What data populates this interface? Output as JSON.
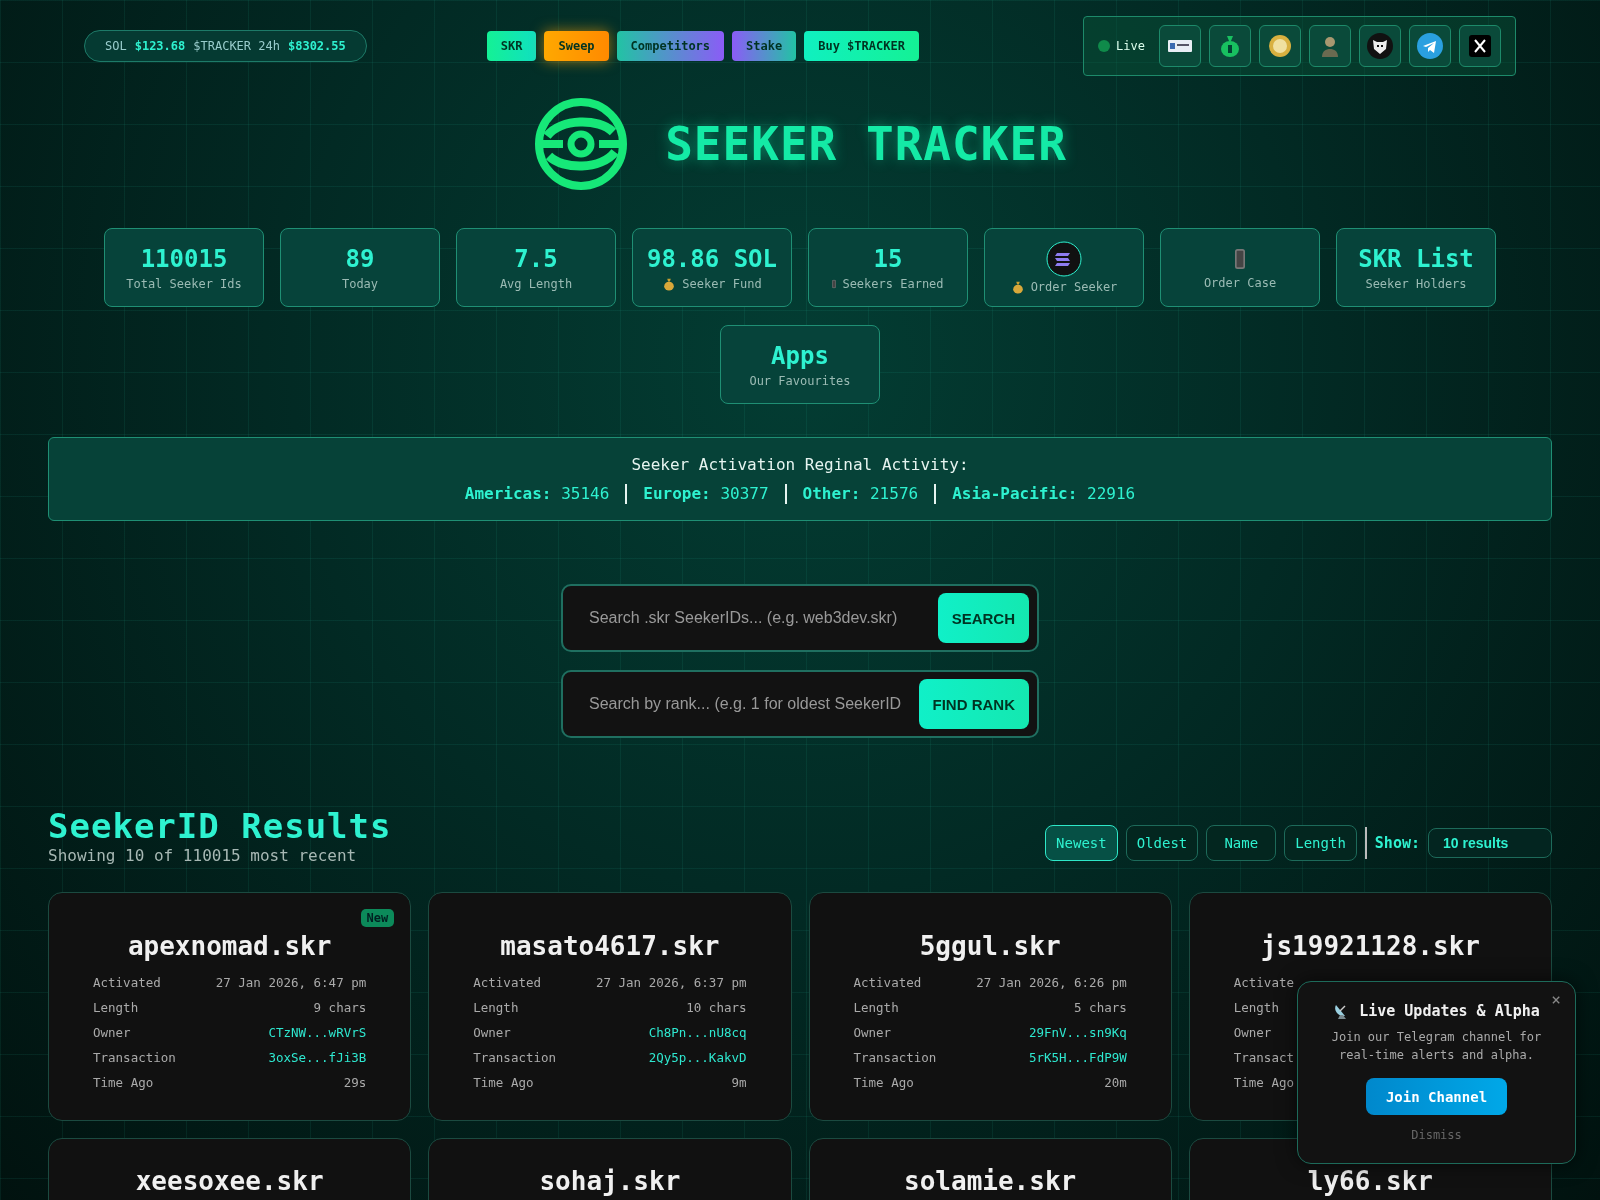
{
  "ticker": [
    {
      "label": "SOL",
      "value": "$123.68"
    },
    {
      "label": "$TRACKER 24h",
      "value": "$8302.55"
    }
  ],
  "nav": [
    {
      "label": "SKR",
      "kind": "skr"
    },
    {
      "label": "Sweep",
      "kind": "sweep"
    },
    {
      "label": "Competitors",
      "kind": "competitors"
    },
    {
      "label": "Stake",
      "kind": "stake"
    },
    {
      "label": "Buy $TRACKER",
      "kind": "buy"
    }
  ],
  "status": {
    "label": "Live",
    "on": true
  },
  "social": [
    {
      "kind": "badge"
    },
    {
      "kind": "money-bag"
    },
    {
      "kind": "coin"
    },
    {
      "kind": "figure"
    },
    {
      "kind": "mask"
    },
    {
      "kind": "telegram"
    },
    {
      "kind": "x"
    }
  ],
  "title": "SEEKER TRACKER",
  "stats": [
    {
      "kind": "text",
      "value": "110015",
      "label": "Total Seeker Ids"
    },
    {
      "kind": "text",
      "value": "89",
      "label": "Today"
    },
    {
      "kind": "text",
      "value": "7.5",
      "label": "Avg Length"
    },
    {
      "kind": "fund",
      "value": "98.86 SOL",
      "label": "Seeker Fund"
    },
    {
      "kind": "earned",
      "value": "15",
      "label": "Seekers Earned"
    },
    {
      "kind": "logo",
      "label": "Order Seeker"
    },
    {
      "kind": "phone",
      "label": "Order Case"
    },
    {
      "kind": "text",
      "value": "SKR List",
      "label": "Seeker Holders"
    },
    {
      "kind": "text",
      "value": "Apps",
      "label": "Our Favourites"
    }
  ],
  "region": {
    "title": "Seeker Activation Reginal Activity:",
    "items": [
      {
        "label": "Americas:",
        "value": "35146"
      },
      {
        "label": "Europe:",
        "value": "30377"
      },
      {
        "label": "Other:",
        "value": "21576"
      },
      {
        "label": "Asia-Pacific:",
        "value": "22916"
      }
    ]
  },
  "searches": [
    {
      "placeholder": "Search .skr SeekerIDs... (e.g. web3dev.skr)",
      "button": "SEARCH"
    },
    {
      "placeholder": "Search by rank... (e.g. 1 for oldest SeekerID",
      "button": "FIND RANK"
    }
  ],
  "results": {
    "title": "SeekerID Results",
    "subtitle": "Showing 10 of 110015 most recent",
    "sort": [
      {
        "label": "Newest",
        "selected": true
      },
      {
        "label": "Oldest",
        "selected": false
      },
      {
        "label": "Name",
        "selected": false
      },
      {
        "label": "Length",
        "selected": false
      }
    ],
    "show_label": "Show:",
    "show_value": "10 results"
  },
  "cards": [
    {
      "name": "apexnomad.skr",
      "badge": "New",
      "rows": [
        {
          "label": "Activated",
          "value": "27 Jan 2026, 6:47 pm",
          "kind": "plain"
        },
        {
          "label": "Length",
          "value": "9 chars",
          "kind": "plain"
        },
        {
          "label": "Owner",
          "value": "CTzNW...wRVrS",
          "kind": "link"
        },
        {
          "label": "Transaction",
          "value": "3oxSe...fJi3B",
          "kind": "link"
        },
        {
          "label": "Time Ago",
          "value": "29s",
          "kind": "plain"
        }
      ]
    },
    {
      "name": "masato4617.skr",
      "rows": [
        {
          "label": "Activated",
          "value": "27 Jan 2026, 6:37 pm",
          "kind": "plain"
        },
        {
          "label": "Length",
          "value": "10 chars",
          "kind": "plain"
        },
        {
          "label": "Owner",
          "value": "Ch8Pn...nU8cq",
          "kind": "link"
        },
        {
          "label": "Transaction",
          "value": "2Qy5p...KakvD",
          "kind": "link"
        },
        {
          "label": "Time Ago",
          "value": "9m",
          "kind": "plain"
        }
      ]
    },
    {
      "name": "5ggul.skr",
      "rows": [
        {
          "label": "Activated",
          "value": "27 Jan 2026, 6:26 pm",
          "kind": "plain"
        },
        {
          "label": "Length",
          "value": "5 chars",
          "kind": "plain"
        },
        {
          "label": "Owner",
          "value": "29FnV...sn9Kq",
          "kind": "link"
        },
        {
          "label": "Transaction",
          "value": "5rK5H...FdP9W",
          "kind": "link"
        },
        {
          "label": "Time Ago",
          "value": "20m",
          "kind": "plain"
        }
      ]
    },
    {
      "name": "js19921128.skr",
      "rows": [
        {
          "label": "Activate"
        },
        {
          "label": "Length"
        },
        {
          "label": "Owner"
        },
        {
          "label": "Transact"
        },
        {
          "label": "Time Ago"
        }
      ]
    },
    {
      "name": "xeesoxee.skr"
    },
    {
      "name": "sohaj.skr"
    },
    {
      "name": "solamie.skr"
    },
    {
      "name": "ly66.skr"
    }
  ],
  "popup": {
    "close": "×",
    "title": "Live Updates & Alpha",
    "text": "Join our Telegram channel for real-time alerts and alpha.",
    "button": "Join Channel",
    "dismiss": "Dismiss"
  }
}
